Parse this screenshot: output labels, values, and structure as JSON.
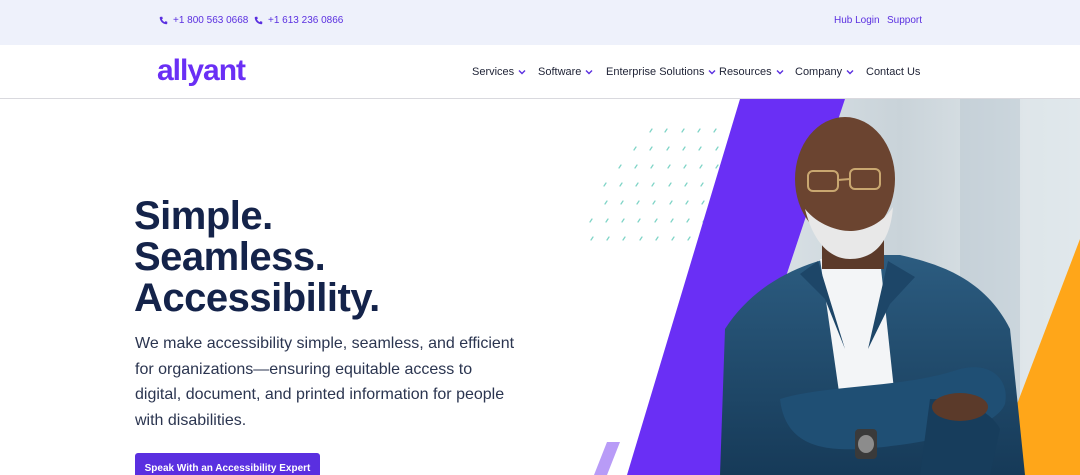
{
  "topbar": {
    "phone_1": "+1 800 563 0668",
    "phone_2": "+1 613 236 0866",
    "hub_login": "Hub Login",
    "support": "Support"
  },
  "brand": {
    "logo_text": "allyant",
    "accent_color": "#5a2fe0"
  },
  "nav": {
    "items": [
      {
        "label": "Services",
        "has_dropdown": true
      },
      {
        "label": "Software",
        "has_dropdown": true
      },
      {
        "label": "Enterprise Solutions",
        "has_dropdown": true
      },
      {
        "label": "Resources",
        "has_dropdown": true
      },
      {
        "label": "Company",
        "has_dropdown": true
      },
      {
        "label": "Contact Us",
        "has_dropdown": false
      }
    ]
  },
  "hero": {
    "title_line_1": "Simple.",
    "title_line_2": "Seamless.",
    "title_line_3": "Accessibility.",
    "description": "We make accessibility simple, seamless, and efficient for organizations—ensuring equitable access to digital, document, and printed information for people with disabilities.",
    "cta_label": "Speak With an Accessibility Expert"
  },
  "icons": {
    "phone": "phone-icon",
    "chevron": "chevron-down-icon"
  }
}
